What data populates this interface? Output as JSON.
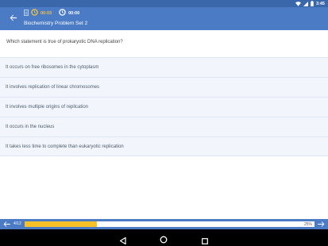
{
  "status_bar": {
    "time": "3:45"
  },
  "app_bar": {
    "elapsed_time": "00:03",
    "total_time": "00:00",
    "title": "Biochemistry Problem Set 2"
  },
  "question": {
    "text": "Which statement is true of prokaryotic DNA replication?"
  },
  "options": [
    {
      "label": "It occurs on free ribosomes in the cytoplasm"
    },
    {
      "label": "It involves replication of linear chromosomes"
    },
    {
      "label": "It involves multiple origins of replication"
    },
    {
      "label": "It occurs in the nucleus"
    },
    {
      "label": "It takes less time to complete than eukaryotic replication"
    }
  ],
  "progress": {
    "position_label": "4/12",
    "percent_label": "25%",
    "fraction": 0.25
  },
  "colors": {
    "app_bar": "#4a7bc4",
    "status_bar": "#3a67aa",
    "accent_yellow": "#f6c029",
    "option_bg": "#f2f6fc"
  },
  "icons": {
    "back": "arrow-left-icon",
    "document": "document-icon",
    "timer_elapsed": "timer-icon",
    "timer_total": "stopwatch-icon",
    "prev": "arrow-left-icon",
    "next": "arrow-right-icon",
    "wifi": "wifi-icon",
    "signal": "signal-icon",
    "battery": "battery-icon"
  }
}
